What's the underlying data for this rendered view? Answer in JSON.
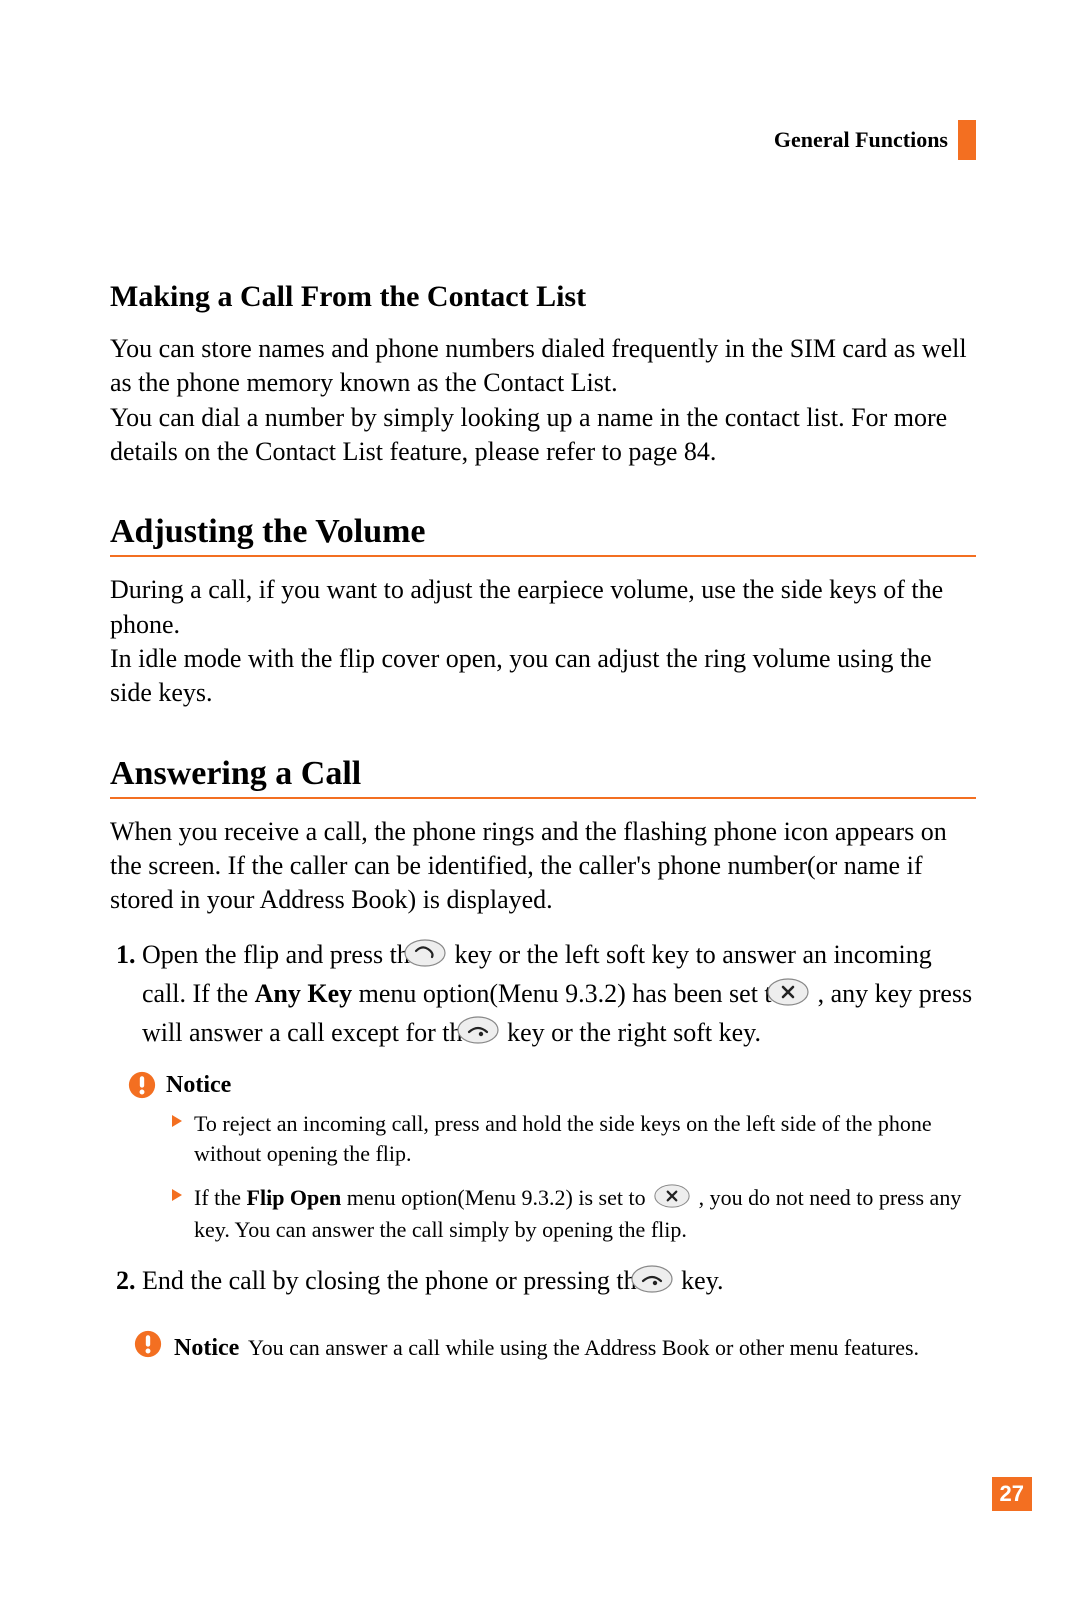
{
  "header": {
    "label": "General Functions"
  },
  "section1": {
    "heading": "Making a Call From the Contact List",
    "para": "You can store names and phone numbers dialed frequently in the SIM card as well as the phone memory known as the Contact List.\nYou can dial a number by simply looking up a name in the contact list. For more details on the Contact List feature, please refer to page 84."
  },
  "section2": {
    "heading": "Adjusting the Volume",
    "para": "During a call, if you want to adjust the earpiece volume, use the side keys of the phone.\nIn idle mode with the flip cover open, you can adjust the ring volume using the side keys."
  },
  "section3": {
    "heading": "Answering a Call",
    "intro": "When you receive a call, the phone rings and the flashing phone icon appears on the screen. If the caller can be identified, the caller's phone number(or name if stored in your Address Book) is displayed.",
    "step1_num": "1.",
    "step1_a": "Open the flip and press the ",
    "step1_b": " key or the left soft key to answer an incoming call. If the ",
    "step1_bold1": "Any Key",
    "step1_c": " menu option(Menu 9.3.2) has been set to ",
    "step1_d": " , any key press will answer a call except for the ",
    "step1_e": " key or the right soft key.",
    "notice_label": "Notice",
    "notice1_a": "To reject an incoming call, press and hold the side keys on the left side of the phone without opening the flip.",
    "notice2_a": "If the ",
    "notice2_bold": "Flip Open",
    "notice2_b": " menu option(Menu 9.3.2) is set to ",
    "notice2_c": " , you do not need to press any key. You can answer the call simply by opening the flip.",
    "step2_num": "2.",
    "step2_a": "End the call by closing the phone or pressing the ",
    "step2_b": " key.",
    "notice3_label": "Notice",
    "notice3_text": "You can answer a call while using the Address Book or other menu features."
  },
  "page_number": "27",
  "icons": {
    "send_key": "send-key-icon",
    "x_key": "x-key-icon",
    "end_key": "end-key-icon",
    "notice": "notice-exclaim-icon",
    "arrow": "orange-arrow-icon"
  }
}
